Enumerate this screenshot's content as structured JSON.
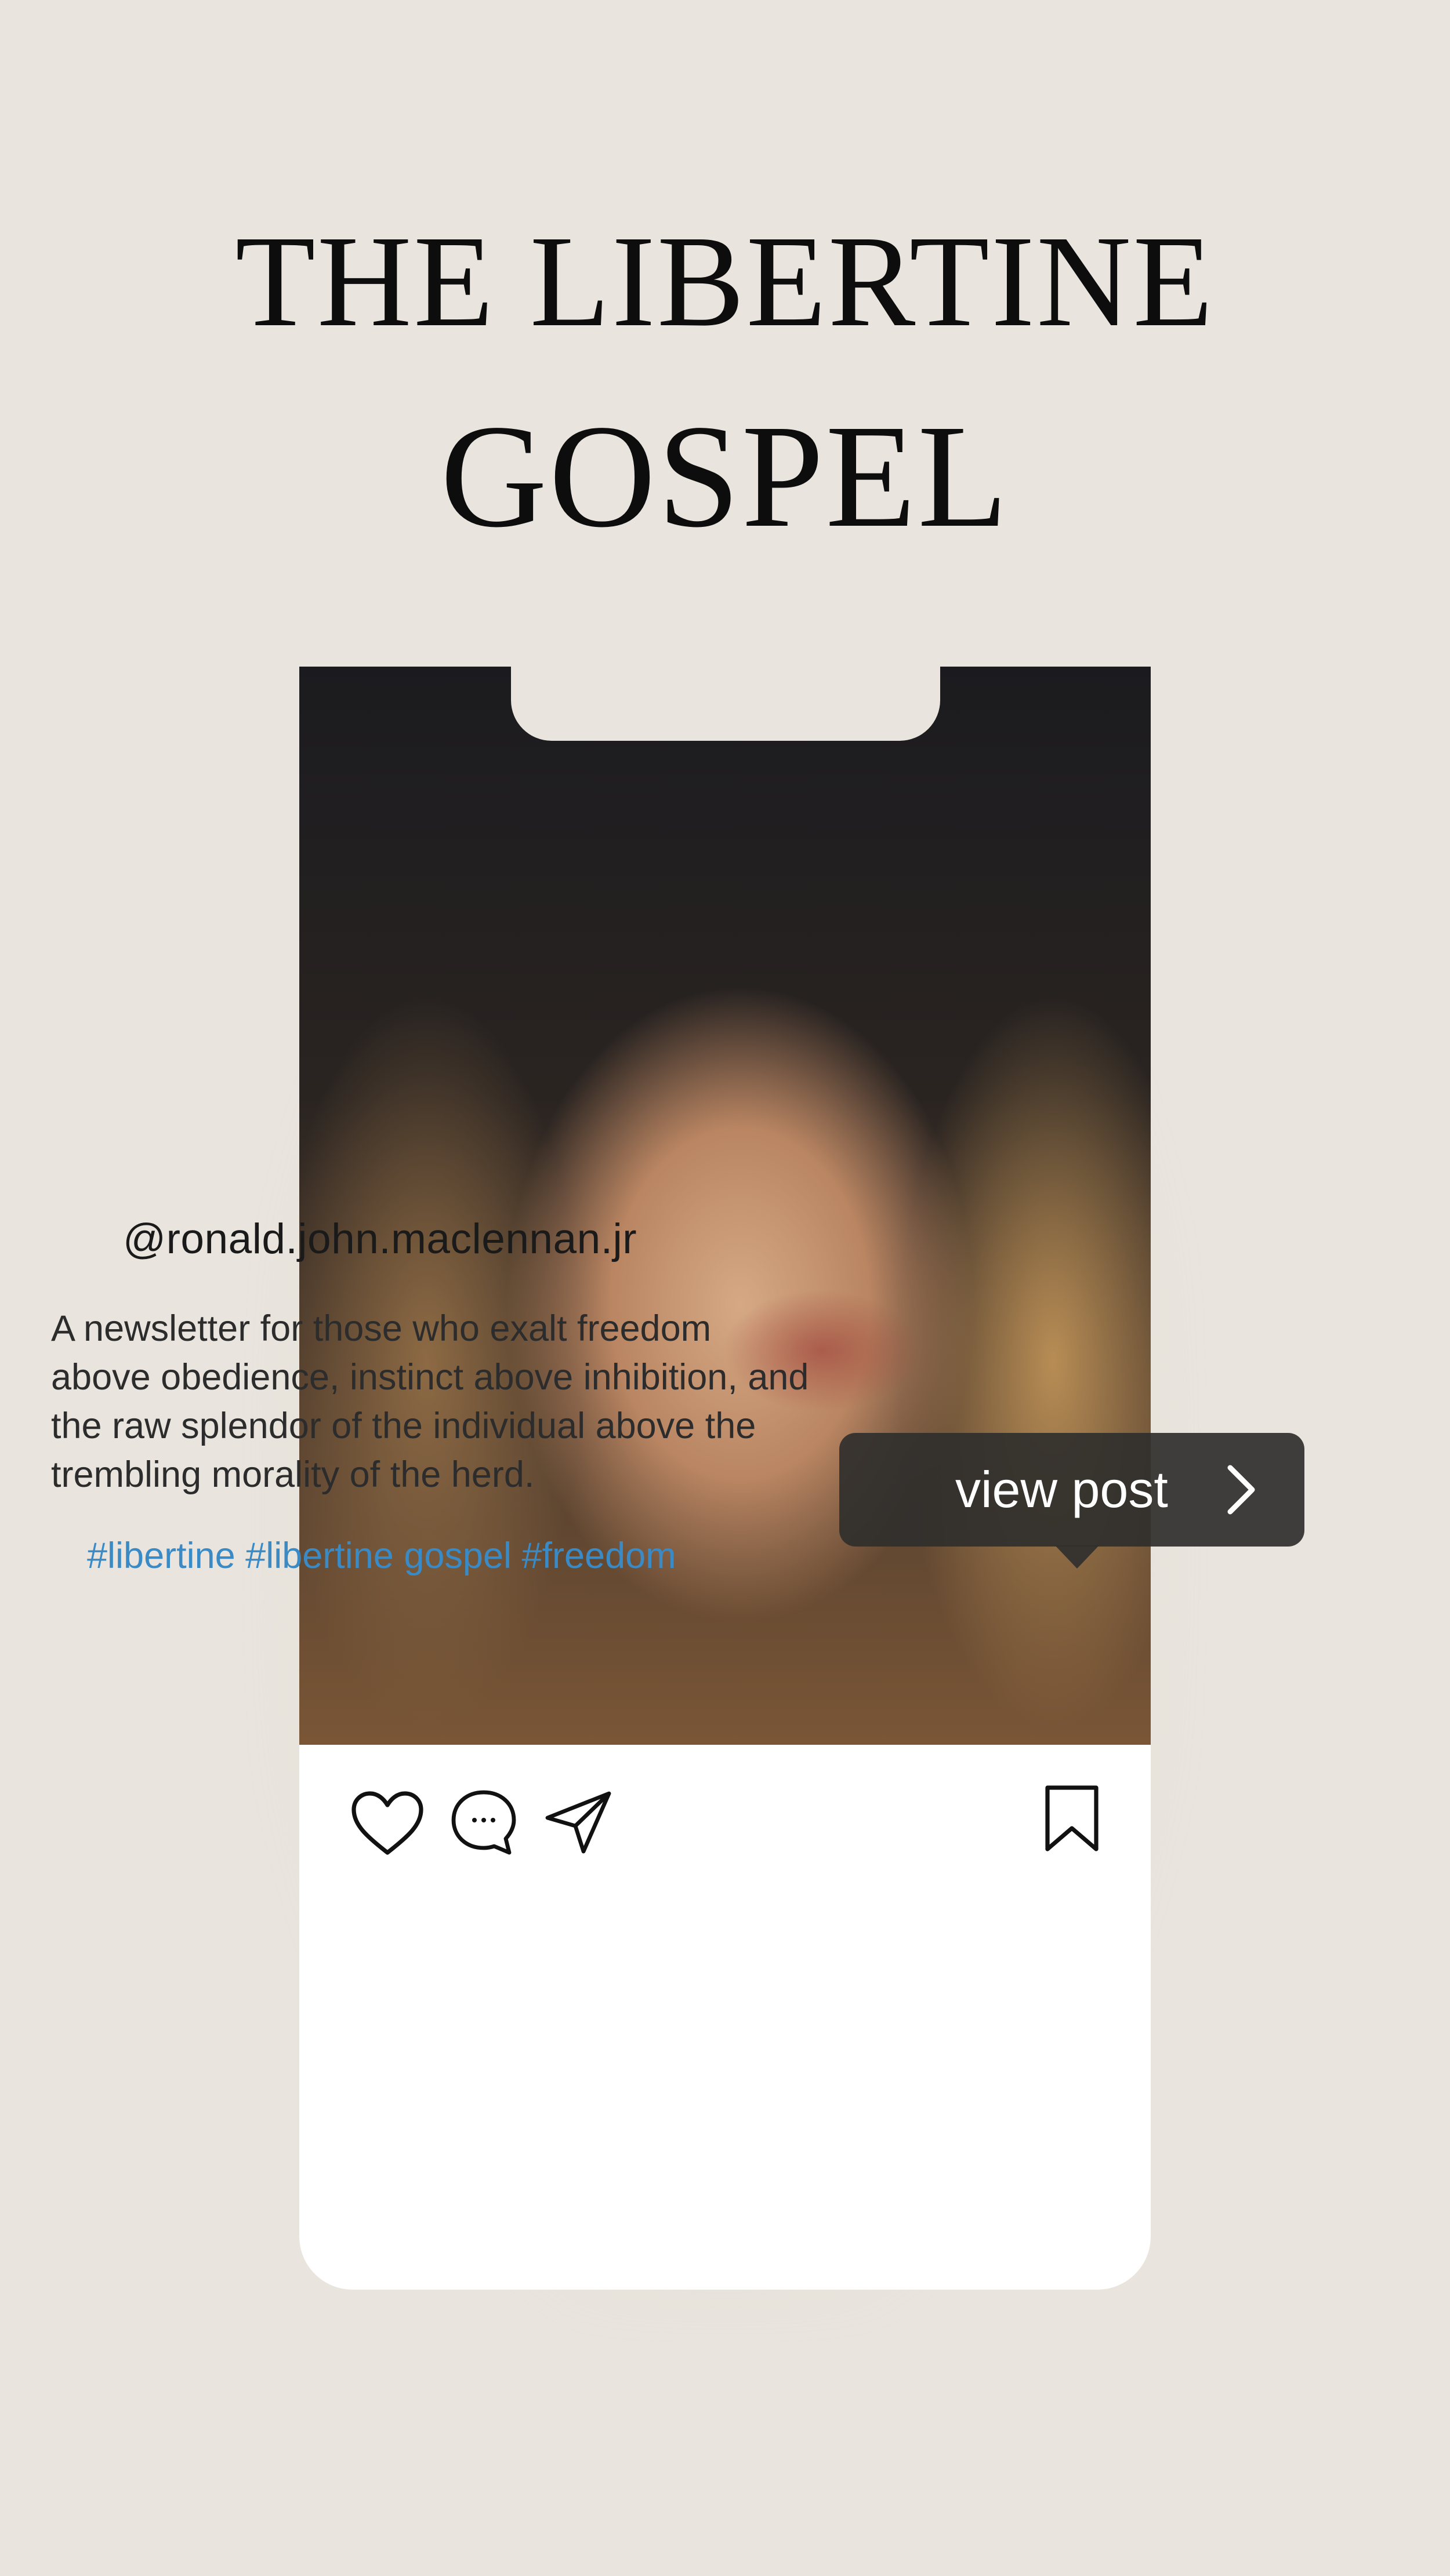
{
  "header": {
    "title_line1": "THE LIBERTINE",
    "title_line2": "GOSPEL"
  },
  "post": {
    "username": "@ronald.john.maclennan.jr",
    "caption": "A newsletter for those who exalt freedom above obedience, instinct above inhibition, and the raw splendor of the individual above the trembling morality of the herd.",
    "hashtags": "#libertine #libertine gospel #freedom",
    "view_post_label": "view post"
  },
  "icons": [
    "heart-icon",
    "comment-icon",
    "share-icon",
    "bookmark-icon",
    "chevron-right-icon"
  ],
  "colors": {
    "background": "#e9e5de",
    "card": "#ffffff",
    "hashtag": "#3a8ac6",
    "button": "#302f2d"
  }
}
